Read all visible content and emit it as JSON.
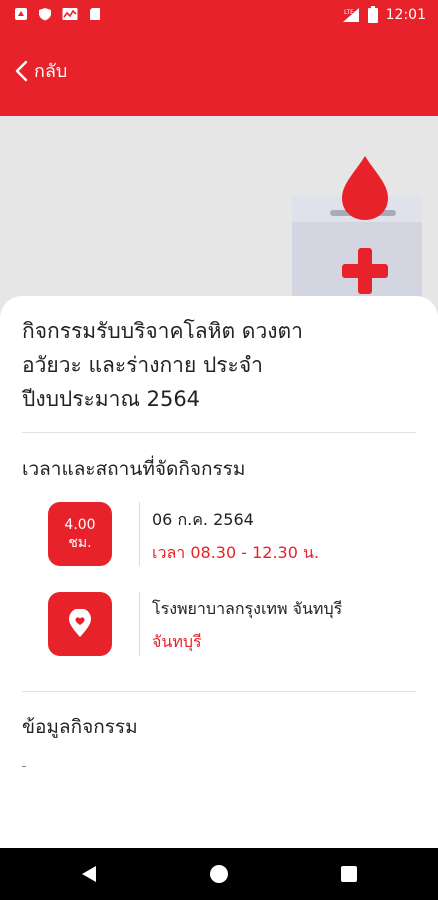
{
  "status_bar": {
    "time": "12:01",
    "network": "LTE"
  },
  "header": {
    "back_label": "กลับ"
  },
  "activity": {
    "title_lines": [
      "กิจกรรมรับบริจาคโลหิต ดวงตา",
      "อวัยวะ และร่างกาย ประจำ",
      "ปีงบประมาณ 2564"
    ]
  },
  "schedule": {
    "heading": "เวลาและสถานที่จัดกิจกรรม",
    "duration_value": "4.00",
    "duration_unit": "ชม.",
    "date": "06 ก.ค. 2564",
    "time_range": "เวลา 08.30 - 12.30 น.",
    "location_name": "โรงพยาบาลกรุงเทพ จันทบุรี",
    "location_province": "จันทบุรี"
  },
  "info": {
    "heading": "ข้อมูลกิจกรรม",
    "body": "-"
  },
  "colors": {
    "accent": "#e8222a",
    "hero_bg": "#e6e6e6"
  },
  "icons": [
    "notification-icon",
    "shield-icon",
    "chart-icon",
    "sdcard-icon",
    "signal-icon",
    "battery-icon",
    "chevron-left-icon",
    "blood-drop-icon",
    "map-pin-icon",
    "back-triangle-icon",
    "home-circle-icon",
    "recents-square-icon"
  ]
}
